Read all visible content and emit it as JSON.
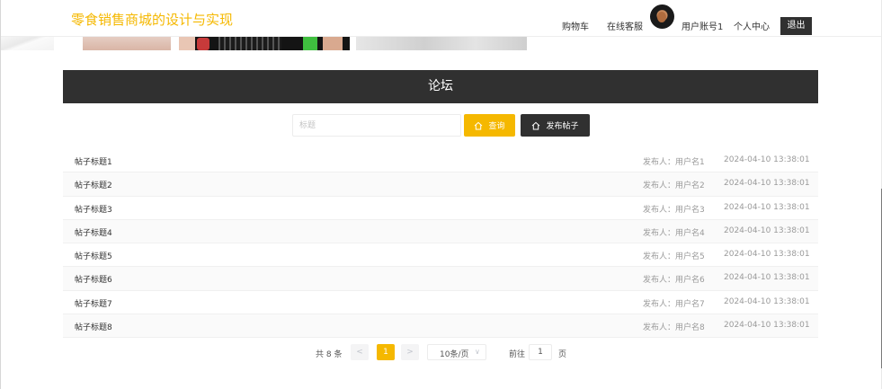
{
  "header": {
    "logo": "零食销售商城的设计与实现",
    "nav": {
      "cart": "购物车",
      "service": "在线客服",
      "username": "用户账号1",
      "profile": "个人中心",
      "logout": "退出"
    }
  },
  "forum": {
    "title": "论坛",
    "search": {
      "placeholder": "标题",
      "query_label": "查询",
      "post_label": "发布帖子"
    },
    "posts": [
      {
        "title": "帖子标题1",
        "author": "发布人：用户名1",
        "time": "2024-04-10 13:38:01"
      },
      {
        "title": "帖子标题2",
        "author": "发布人：用户名2",
        "time": "2024-04-10 13:38:01"
      },
      {
        "title": "帖子标题3",
        "author": "发布人：用户名3",
        "time": "2024-04-10 13:38:01"
      },
      {
        "title": "帖子标题4",
        "author": "发布人：用户名4",
        "time": "2024-04-10 13:38:01"
      },
      {
        "title": "帖子标题5",
        "author": "发布人：用户名5",
        "time": "2024-04-10 13:38:01"
      },
      {
        "title": "帖子标题6",
        "author": "发布人：用户名6",
        "time": "2024-04-10 13:38:01"
      },
      {
        "title": "帖子标题7",
        "author": "发布人：用户名7",
        "time": "2024-04-10 13:38:01"
      },
      {
        "title": "帖子标题8",
        "author": "发布人：用户名8",
        "time": "2024-04-10 13:38:01"
      }
    ]
  },
  "pagination": {
    "total": "共 8 条",
    "prev": "<",
    "current": "1",
    "next": ">",
    "page_size": "10条/页",
    "goto_label": "前往",
    "goto_value": "1",
    "page_unit": "页"
  },
  "colors": {
    "accent": "#f5b800",
    "dark": "#303030"
  }
}
